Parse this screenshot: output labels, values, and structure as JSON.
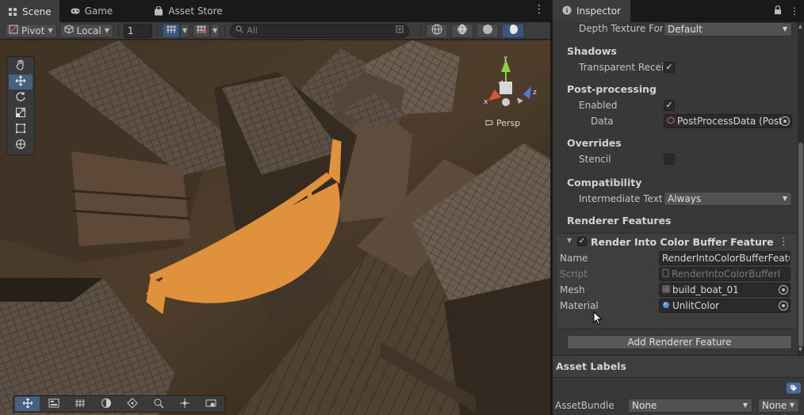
{
  "scene": {
    "tabs": [
      {
        "label": "Scene",
        "icon": "grid-icon",
        "active": true
      },
      {
        "label": "Game",
        "icon": "gamepad-icon",
        "active": false
      },
      {
        "label": "Asset Store",
        "icon": "bag-icon",
        "active": false
      }
    ],
    "menu_glyph": "⋮",
    "toolbar": {
      "pivot_label": "Pivot",
      "local_label": "Local",
      "increment_value": "1",
      "search_placeholder": "All"
    },
    "view_label": "Persp",
    "gizmo_axes": {
      "y": "y",
      "x": "x",
      "z": "z"
    }
  },
  "inspector": {
    "tab_label": "Inspector",
    "menu_glyph": "⋮",
    "rows": {
      "depth_texture": {
        "label": "Depth Texture Forı",
        "value": "Default"
      },
      "shadows_header": "Shadows",
      "transparent_receive": {
        "label": "Transparent Recei",
        "checked": true
      },
      "postprocessing_header": "Post-processing",
      "pp_enabled": {
        "label": "Enabled",
        "checked": true
      },
      "pp_data": {
        "label": "Data",
        "value": "PostProcessData (Post"
      },
      "overrides_header": "Overrides",
      "stencil": {
        "label": "Stencil",
        "checked": false
      },
      "compatibility_header": "Compatibility",
      "intermediate_texture": {
        "label": "Intermediate Textu",
        "value": "Always"
      },
      "renderer_features_header": "Renderer Features"
    },
    "feature": {
      "title": "Render Into Color Buffer Feature",
      "enabled": true,
      "name": {
        "label": "Name",
        "value": "RenderIntoColorBufferFeatu"
      },
      "script": {
        "label": "Script",
        "value": "RenderIntoColorBufferI"
      },
      "mesh": {
        "label": "Mesh",
        "value": "build_boat_01"
      },
      "material": {
        "label": "Material",
        "value": "UnlitColor"
      }
    },
    "add_feature_label": "Add Renderer Feature",
    "asset_labels": {
      "header": "Asset Labels",
      "assetbundle_label": "AssetBundle",
      "bundle_value": "None",
      "variant_value": "None"
    }
  },
  "colors": {
    "boat_highlight": "#ffa544",
    "accent_blue": "#46607f",
    "panel_bg": "#383838"
  }
}
